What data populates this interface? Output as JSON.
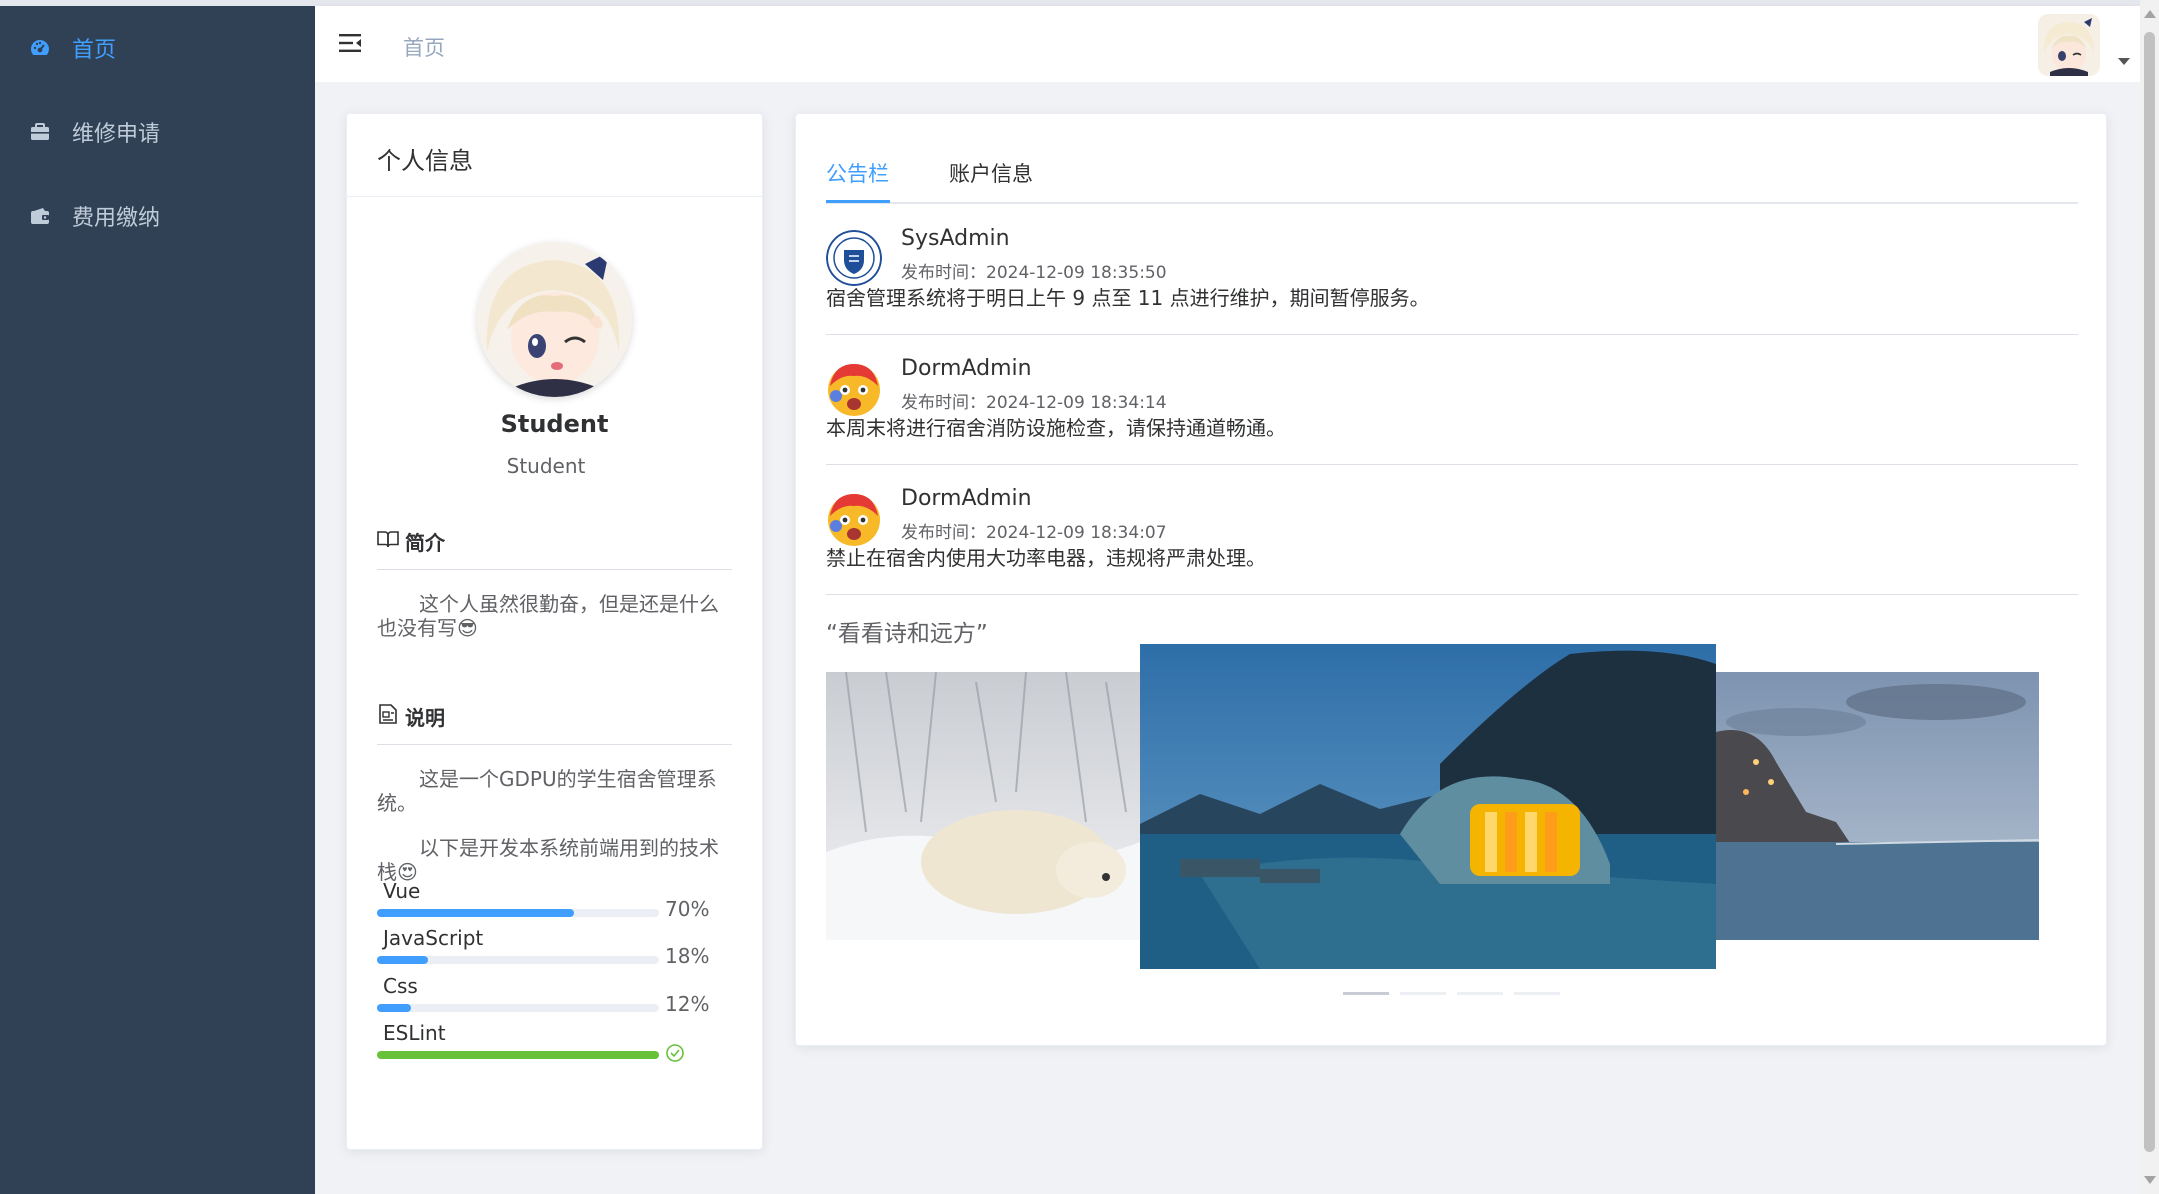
{
  "sidebar": {
    "items": [
      {
        "label": "首页",
        "icon": "dashboard-icon",
        "active": true
      },
      {
        "label": "维修申请",
        "icon": "briefcase-icon",
        "active": false
      },
      {
        "label": "费用缴纳",
        "icon": "wallet-icon",
        "active": false
      }
    ]
  },
  "header": {
    "breadcrumb": "首页"
  },
  "profile": {
    "card_title": "个人信息",
    "name": "Student",
    "role": "Student",
    "intro_title": "简介",
    "intro_text": "这个人虽然很勤奋，但是还是什么也没有写😎",
    "desc_title": "说明",
    "desc_text1": "这是一个GDPU的学生宿舍管理系统。",
    "desc_text2": "以下是开发本系统前端用到的技术栈😍",
    "skills": [
      {
        "name": "Vue",
        "percent": 70,
        "label": "70%"
      },
      {
        "name": "JavaScript",
        "percent": 18,
        "label": "18%"
      },
      {
        "name": "Css",
        "percent": 12,
        "label": "12%"
      },
      {
        "name": "ESLint",
        "percent": 100,
        "label": ""
      }
    ]
  },
  "notice": {
    "tabs": [
      {
        "label": "公告栏",
        "active": true
      },
      {
        "label": "账户信息",
        "active": false
      }
    ],
    "posts": [
      {
        "author": "SysAdmin",
        "time": "发布时间：2024-12-09 18:35:50",
        "text": "宿舍管理系统将于明日上午 9 点至 11 点进行维护，期间暂停服务。",
        "avatar": "university-seal-icon"
      },
      {
        "author": "DormAdmin",
        "time": "发布时间：2024-12-09 18:34:14",
        "text": "本周末将进行宿舍消防设施检查，请保持通道畅通。",
        "avatar": "emoji-face-icon"
      },
      {
        "author": "DormAdmin",
        "time": "发布时间：2024-12-09 18:34:07",
        "text": "禁止在宿舍内使用大功率电器，违规将严肃处理。",
        "avatar": "emoji-face-icon"
      }
    ],
    "poem_title": "“看看诗和远方”",
    "carousel": {
      "slide_count": 4,
      "active_index": 0
    }
  },
  "colors": {
    "sidebar_bg": "#304156",
    "accent": "#409eff",
    "success": "#67c23a"
  }
}
